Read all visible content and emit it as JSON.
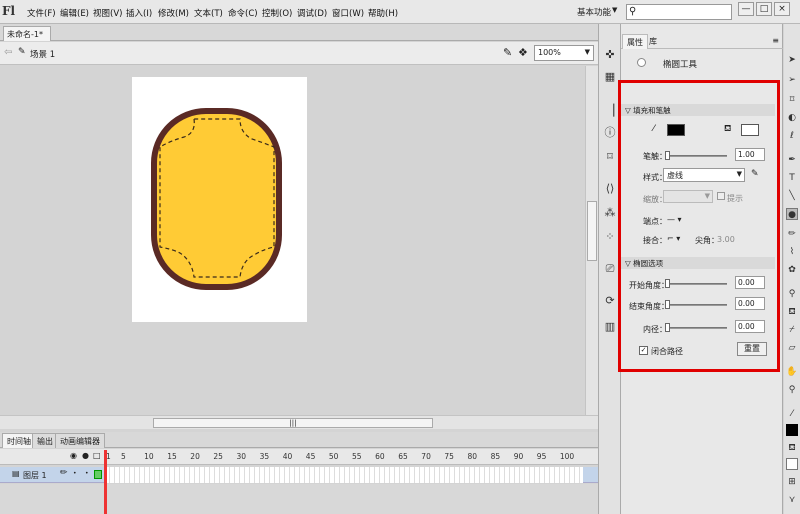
{
  "app": {
    "logo": "Fl"
  },
  "menus": [
    "文件(F)",
    "编辑(E)",
    "视图(V)",
    "插入(I)",
    "修改(M)",
    "文本(T)",
    "命令(C)",
    "控制(O)",
    "调试(D)",
    "窗口(W)",
    "帮助(H)"
  ],
  "workspace": {
    "label": "基本功能"
  },
  "search": {
    "value": ""
  },
  "window_buttons": [
    "—",
    "□",
    "×"
  ],
  "document": {
    "tab_title": "未命名-1*",
    "close": "×",
    "scene": "场景 1",
    "zoom": "100%"
  },
  "timeline": {
    "tabs": [
      "时间轴",
      "输出",
      "动画编辑器"
    ],
    "frame_numbers": [
      "1",
      "5",
      "10",
      "15",
      "20",
      "25",
      "30",
      "35",
      "40",
      "45",
      "50",
      "55",
      "60",
      "65",
      "70",
      "75",
      "80",
      "85",
      "90",
      "95",
      "100"
    ],
    "layer_name": "图层 1"
  },
  "properties": {
    "tabs": [
      "属性",
      "库"
    ],
    "tool_name": "椭圆工具",
    "fill_stroke": {
      "header": "填充和笔触",
      "stroke_label": "笔触：",
      "stroke_value": "1.00",
      "style_label": "样式：",
      "style_value": "虚线",
      "scale_label": "缩放：",
      "hint_label": "提示",
      "cap_label": "端点：",
      "join_label": "接合：",
      "miter_label": "尖角：",
      "miter_value": "3.00",
      "stroke_color": "#000000",
      "fill_color": "#ffffff"
    },
    "ellipse_options": {
      "header": "椭圆选项",
      "start_label": "开始角度：",
      "start_value": "0.00",
      "end_label": "结束角度：",
      "end_value": "0.00",
      "inner_label": "内径：",
      "inner_value": "0.00",
      "close_path_label": "闭合路径",
      "reset_label": "重置"
    }
  },
  "canvas": {
    "shape_fill": "#FFCB35",
    "shape_stroke": "#5A2A25",
    "dash_color": "#3a2a1a"
  },
  "colors": {
    "highlight": "#e00000"
  }
}
